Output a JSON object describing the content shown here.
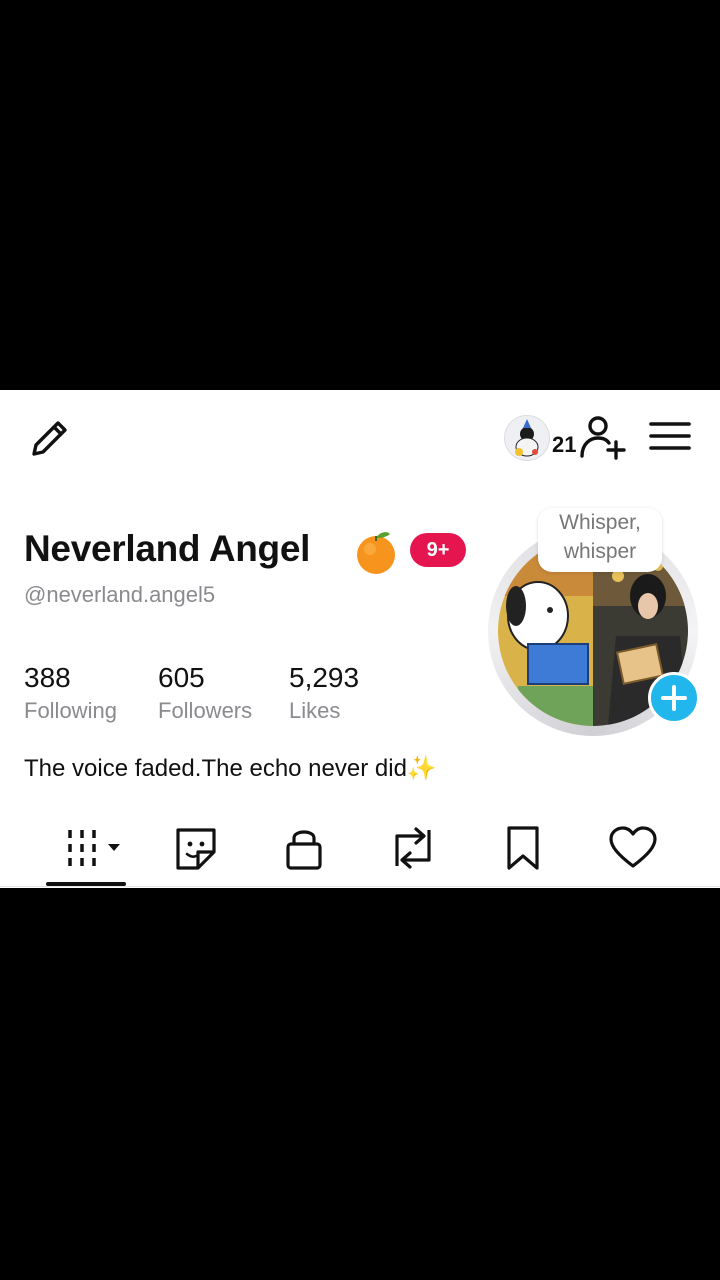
{
  "header": {
    "edit_icon": "pencil-icon",
    "friends_count": "21",
    "add_user_icon": "add-user-icon",
    "menu_icon": "hamburger-menu-icon"
  },
  "profile": {
    "display_name": "Neverland Angel",
    "name_emoji": "tangerine-emoji",
    "badge": "9+",
    "handle": "@neverland.angel5",
    "bio": "The voice faded.The echo never did✨",
    "status_bubble": {
      "line1": "Whisper,",
      "line2": "whisper"
    }
  },
  "stats": [
    {
      "value": "388",
      "label": "Following"
    },
    {
      "value": "605",
      "label": "Followers"
    },
    {
      "value": "5,293",
      "label": "Likes"
    }
  ],
  "tabs": [
    {
      "icon": "videos-grid-icon",
      "selected": true
    },
    {
      "icon": "sticker-icon",
      "selected": false
    },
    {
      "icon": "lock-icon",
      "selected": false
    },
    {
      "icon": "repost-icon",
      "selected": false
    },
    {
      "icon": "bookmark-icon",
      "selected": false
    },
    {
      "icon": "heart-icon",
      "selected": false
    }
  ],
  "colors": {
    "badge": "#e5164f",
    "add_story": "#22b7ec",
    "muted_text": "#8a8a8f"
  }
}
